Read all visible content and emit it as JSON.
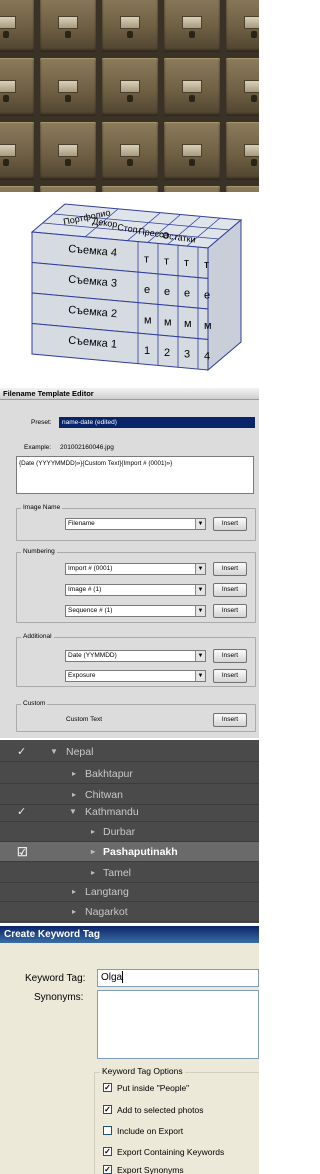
{
  "diagram": {
    "top_labels": [
      "Портфолио",
      "Декор",
      "Стоп",
      "Пресса",
      "Остатки"
    ],
    "rows": [
      "Съемка 4",
      "Съемка 3",
      "Съемка 2",
      "Съемка 1"
    ],
    "side_letters": [
      "т",
      "е",
      "м",
      "а"
    ],
    "side_numbers": [
      "1",
      "2",
      "3",
      "4"
    ]
  },
  "filename_editor": {
    "title": "Filename Template Editor",
    "preset_label": "Preset:",
    "preset_value": "name-date (edited)",
    "example_label": "Example:",
    "example_value": "201002160046.jpg",
    "template": "{Date (YYYYMMDD)»}{Custom Text}{Import # (0001)»}",
    "insert": "Insert",
    "groups": {
      "image_name": {
        "title": "Image Name",
        "fields": [
          "Filename"
        ]
      },
      "numbering": {
        "title": "Numbering",
        "fields": [
          "Import # (0001)",
          "Image # (1)",
          "Sequence # (1)"
        ]
      },
      "additional": {
        "title": "Additional",
        "fields": [
          "Date (YYMMDD)",
          "Exposure"
        ]
      },
      "custom": {
        "title": "Custom",
        "label": "Custom Text"
      }
    }
  },
  "keyword_tree": {
    "items": [
      {
        "label": "Nepal",
        "checked": true
      },
      {
        "label": "Bakhtapur"
      },
      {
        "label": "Chitwan"
      },
      {
        "label": "Kathmandu",
        "checked": true
      },
      {
        "label": "Durbar"
      },
      {
        "label": "Pashaputinakh",
        "selected": true
      },
      {
        "label": "Tamel"
      },
      {
        "label": "Langtang"
      },
      {
        "label": "Nagarkot"
      }
    ]
  },
  "create_keyword": {
    "title": "Create Keyword Tag",
    "keyword_label": "Keyword Tag:",
    "keyword_value": "Olga",
    "synonyms_label": "Synonyms:",
    "options_title": "Keyword Tag Options",
    "options": [
      {
        "label": "Put inside \"People\"",
        "checked": true
      },
      {
        "label": "Add to selected photos",
        "checked": true
      },
      {
        "label": "Include on Export",
        "checked": false
      },
      {
        "label": "Export Containing Keywords",
        "checked": true
      },
      {
        "label": "Export Synonyms",
        "checked": true
      }
    ]
  }
}
